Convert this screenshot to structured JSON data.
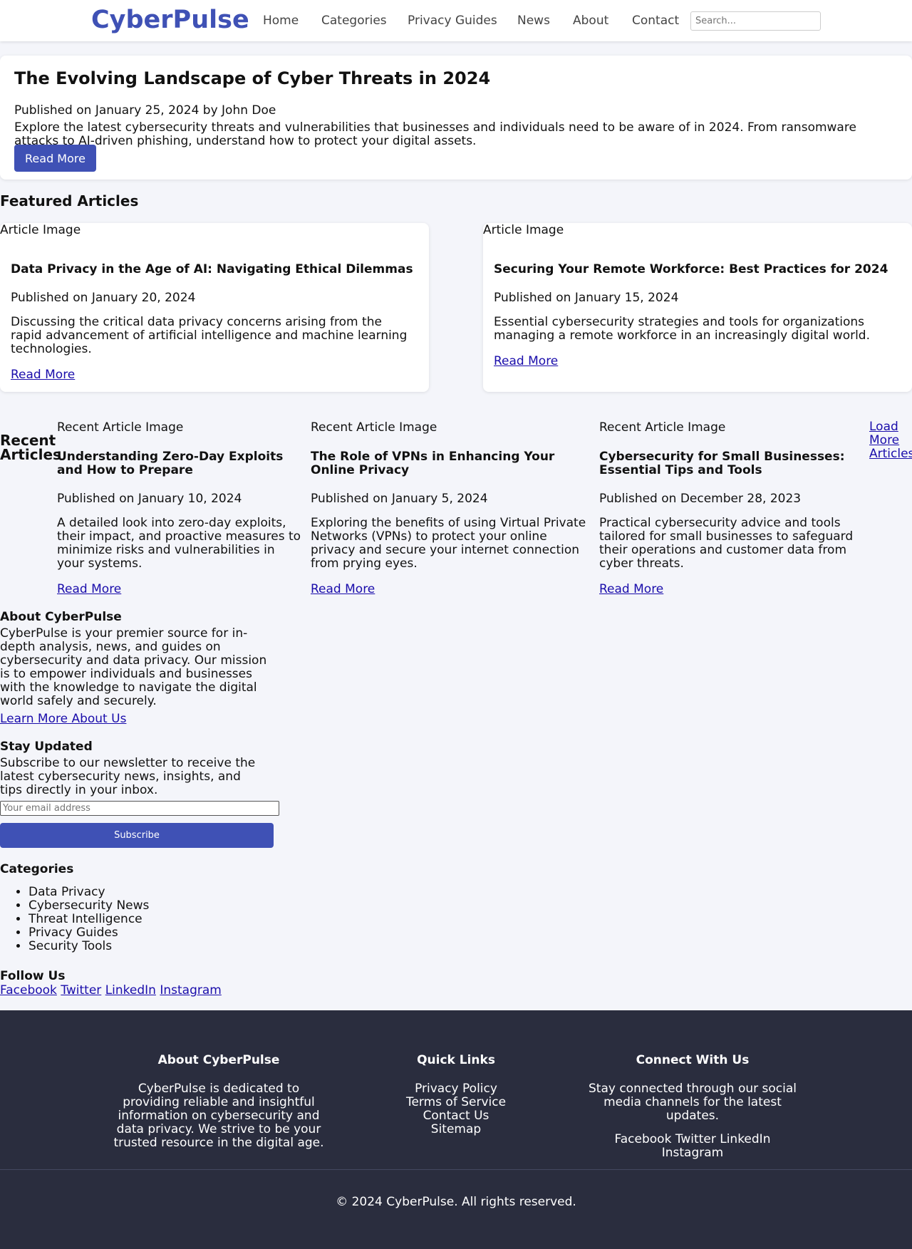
{
  "header": {
    "logo": "CyberPulse",
    "nav": [
      "Home",
      "Categories",
      "Privacy Guides",
      "News",
      "About",
      "Contact"
    ],
    "search_placeholder": "Search..."
  },
  "hero": {
    "title": "The Evolving Landscape of Cyber Threats in 2024",
    "meta": "Published on January 25, 2024 by John Doe",
    "description": "Explore the latest cybersecurity threats and vulnerabilities that businesses and individuals need to be aware of in 2024. From ransomware attacks to AI-driven phishing, understand how to protect your digital assets.",
    "button": "Read More"
  },
  "featured": {
    "title": "Featured Articles",
    "articles": [
      {
        "image_alt": "Article Image",
        "title": "Data Privacy in the Age of AI: Navigating Ethical Dilemmas",
        "meta": "Published on January 20, 2024",
        "description": "Discussing the critical data privacy concerns arising from the rapid advancement of artificial intelligence and machine learning technologies.",
        "link": "Read More"
      },
      {
        "image_alt": "Article Image",
        "title": "Securing Your Remote Workforce: Best Practices for 2024",
        "meta": "Published on January 15, 2024",
        "description": "Essential cybersecurity strategies and tools for organizations managing a remote workforce in an increasingly digital world.",
        "link": "Read More"
      }
    ]
  },
  "recent": {
    "title": "Recent Articles",
    "articles": [
      {
        "image_alt": "Recent Article Image",
        "title": "Understanding Zero-Day Exploits and How to Prepare",
        "meta": "Published on January 10, 2024",
        "description": "A detailed look into zero-day exploits, their impact, and proactive measures to minimize risks and vulnerabilities in your systems.",
        "link": "Read More"
      },
      {
        "image_alt": "Recent Article Image",
        "title": "The Role of VPNs in Enhancing Your Online Privacy",
        "meta": "Published on January 5, 2024",
        "description": "Exploring the benefits of using Virtual Private Networks (VPNs) to protect your online privacy and secure your internet connection from prying eyes.",
        "link": "Read More"
      },
      {
        "image_alt": "Recent Article Image",
        "title": "Cybersecurity for Small Businesses: Essential Tips and Tools",
        "meta": "Published on December 28, 2023",
        "description": "Practical cybersecurity advice and tools tailored for small businesses to safeguard their operations and customer data from cyber threats.",
        "link": "Read More"
      }
    ],
    "load_more": "Load More Articles"
  },
  "sidebar": {
    "about": {
      "title": "About CyberPulse",
      "text": "CyberPulse is your premier source for in-depth analysis, news, and guides on cybersecurity and data privacy. Our mission is to empower individuals and businesses with the knowledge to navigate the digital world safely and securely.",
      "link": "Learn More About Us"
    },
    "newsletter": {
      "title": "Stay Updated",
      "text": "Subscribe to our newsletter to receive the latest cybersecurity news, insights, and tips directly in your inbox.",
      "email_placeholder": "Your email address",
      "button": "Subscribe"
    },
    "categories": {
      "title": "Categories",
      "items": [
        "Data Privacy",
        "Cybersecurity News",
        "Threat Intelligence",
        "Privacy Guides",
        "Security Tools"
      ]
    },
    "follow": {
      "title": "Follow Us",
      "links": [
        "Facebook",
        "Twitter",
        "LinkedIn",
        "Instagram"
      ]
    }
  },
  "footer": {
    "about": {
      "title": "About CyberPulse",
      "text": "CyberPulse is dedicated to providing reliable and insightful information on cybersecurity and data privacy. We strive to be your trusted resource in the digital age."
    },
    "quick_links": {
      "title": "Quick Links",
      "links": [
        "Privacy Policy",
        "Terms of Service",
        "Contact Us",
        "Sitemap"
      ]
    },
    "connect": {
      "title": "Connect With Us",
      "text": "Stay connected through our social media channels for the latest updates.",
      "links": [
        "Facebook",
        "Twitter",
        "LinkedIn",
        "Instagram"
      ]
    },
    "copyright": "© 2024 CyberPulse. All rights reserved."
  },
  "colors": {
    "brand": "#3f51b5",
    "background": "#f4f5fa",
    "footer": "#2a2d3e"
  }
}
